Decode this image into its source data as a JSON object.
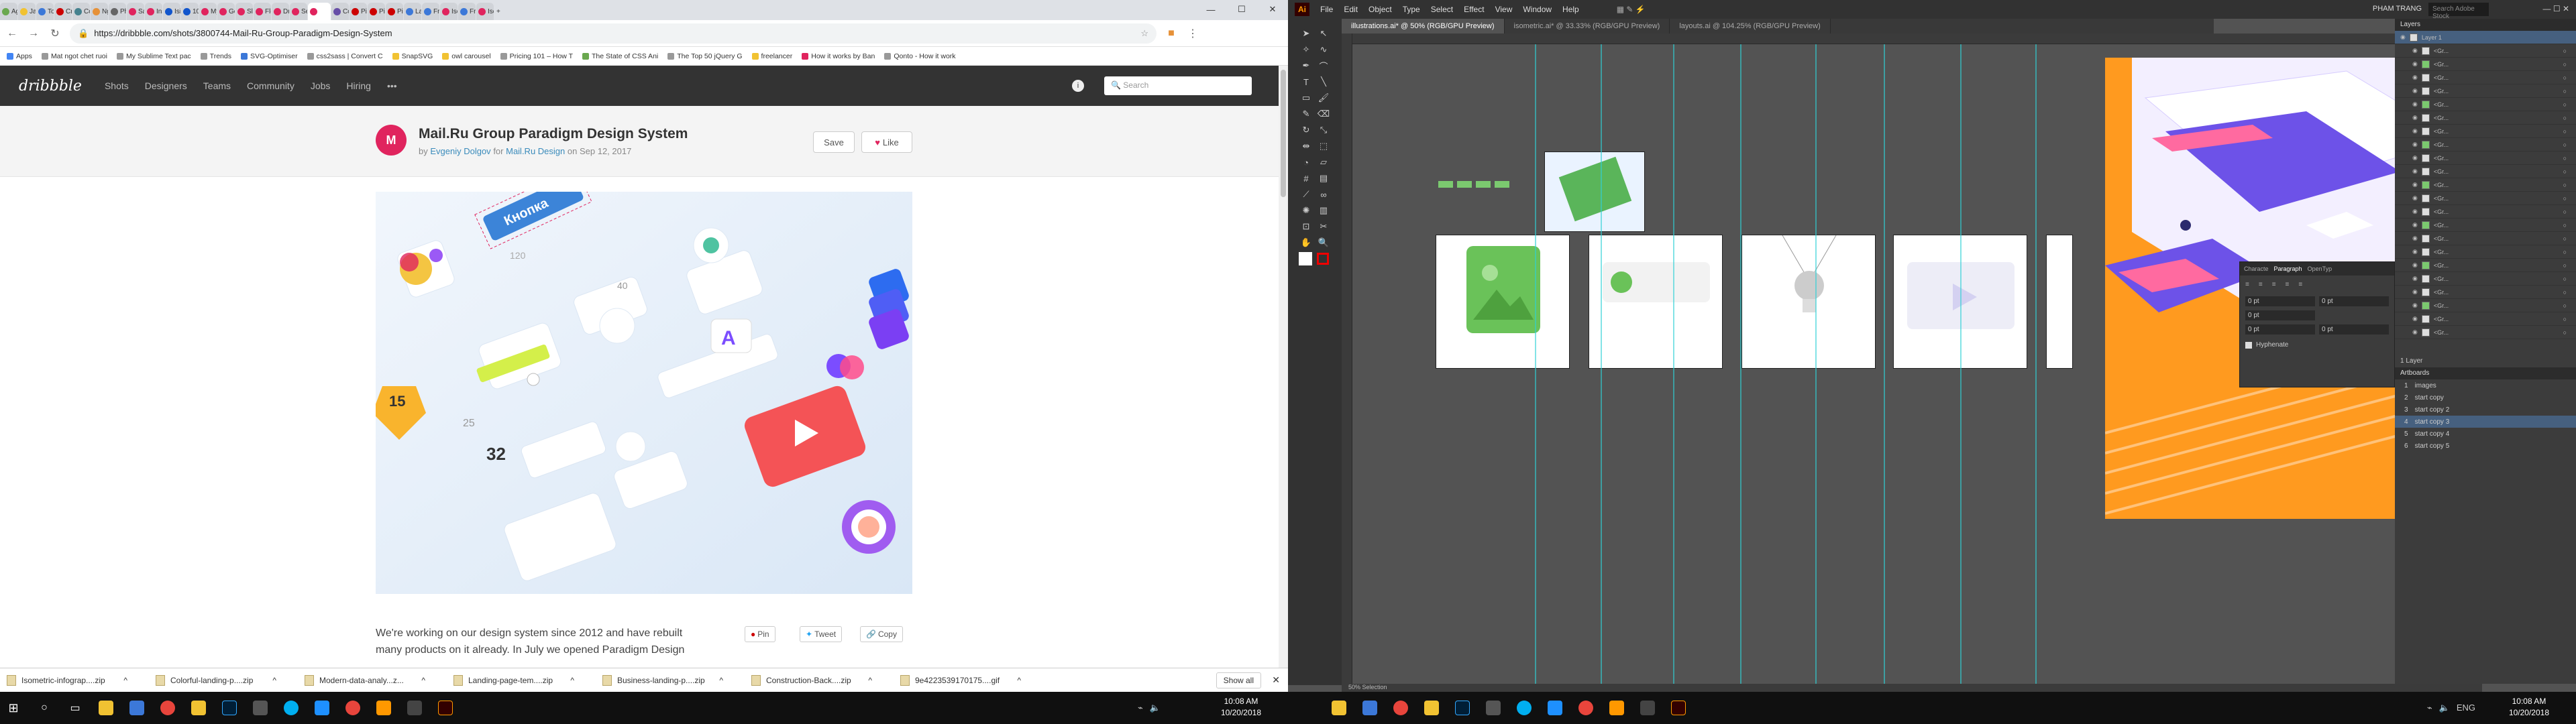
{
  "browser": {
    "tabs": [
      {
        "label": "Agi",
        "color": "#6aa84f"
      },
      {
        "label": "Jav",
        "color": "#f1c232"
      },
      {
        "label": "Toç",
        "color": "#3c78d8"
      },
      {
        "label": "Cre",
        "color": "#cc0000"
      },
      {
        "label": "Co",
        "color": "#45818e"
      },
      {
        "label": "Ng",
        "color": "#e69138"
      },
      {
        "label": "Phi",
        "color": "#666666"
      },
      {
        "label": "San",
        "color": "#e0245e"
      },
      {
        "label": "Ins",
        "color": "#e0245e"
      },
      {
        "label": "Isit",
        "color": "#1155cc"
      },
      {
        "label": "10(",
        "color": "#1155cc"
      },
      {
        "label": "My",
        "color": "#e0245e"
      },
      {
        "label": "Go",
        "color": "#e0245e"
      },
      {
        "label": "Sle",
        "color": "#e0245e"
      },
      {
        "label": "Flo",
        "color": "#e0245e"
      },
      {
        "label": "Dri",
        "color": "#e0245e"
      },
      {
        "label": "Ser",
        "color": "#e0245e"
      },
      {
        "label": "",
        "color": "#e0245e",
        "active": true
      },
      {
        "label": "Co",
        "color": "#674ea7"
      },
      {
        "label": "Pin",
        "color": "#cc0000"
      },
      {
        "label": "Pin",
        "color": "#cc0000"
      },
      {
        "label": "Pin",
        "color": "#cc0000"
      },
      {
        "label": "Lar",
        "color": "#3c78d8"
      },
      {
        "label": "Fre",
        "color": "#3c78d8"
      },
      {
        "label": "Iso",
        "color": "#e0245e"
      },
      {
        "label": "Fre",
        "color": "#3c78d8"
      },
      {
        "label": "Iso",
        "color": "#e0245e"
      }
    ],
    "url": "https://dribbble.com/shots/3800744-Mail-Ru-Group-Paradigm-Design-System",
    "bookmarks": [
      {
        "label": "Apps",
        "color": "#4285f4"
      },
      {
        "label": "Mat ngot chet ruoi",
        "color": "#999999"
      },
      {
        "label": "My Sublime Text pac",
        "color": "#999999"
      },
      {
        "label": "Trends",
        "color": "#999999"
      },
      {
        "label": "SVG-Optimiser",
        "color": "#3c78d8"
      },
      {
        "label": "css2sass | Convert C",
        "color": "#999999"
      },
      {
        "label": "SnapSVG",
        "color": "#f1c232"
      },
      {
        "label": "owl carousel",
        "color": "#f1c232"
      },
      {
        "label": "Pricing 101 – How T",
        "color": "#999999"
      },
      {
        "label": "The State of CSS Ani",
        "color": "#6aa84f"
      },
      {
        "label": "The Top 50 jQuery G",
        "color": "#999999"
      },
      {
        "label": "freelancer",
        "color": "#f1c232"
      },
      {
        "label": "How it works by Ban",
        "color": "#e0245e"
      },
      {
        "label": "Qonto - How it work",
        "color": "#999999"
      }
    ]
  },
  "dribbble": {
    "logo": "dribbble",
    "nav": [
      "Shots",
      "Designers",
      "Teams",
      "Community",
      "Jobs",
      "Hiring",
      "•••"
    ],
    "search_placeholder": "Search",
    "info": "i",
    "shot": {
      "title": "Mail.Ru Group Paradigm Design System",
      "by": "by",
      "author": "Evgeniy Dolgov",
      "for": "for",
      "team": "Mail.Ru Design",
      "on": "on",
      "date": "Sep 12, 2017",
      "avatar_letter": "M",
      "save_label": "Save",
      "like_label": "Like",
      "image_text": "Кнопка",
      "image_numbers": [
        "15",
        "25",
        "32",
        "40",
        "120"
      ],
      "description": "We're working on our design system since 2012 and have rebuilt many products on it already. In July we opened Paradigm Design",
      "share": [
        "Pin",
        "Tweet",
        "Copy"
      ]
    }
  },
  "downloads": {
    "items": [
      "Isometric-infograp....zip",
      "Colorful-landing-p....zip",
      "Modern-data-analy...z...",
      "Landing-page-tem....zip",
      "Business-landing-p....zip",
      "Construction-Back....zip",
      "9e4223539170175....gif"
    ],
    "show_all": "Show all"
  },
  "taskbar_left": {
    "time": "10:08 AM",
    "date": "10/20/2018"
  },
  "illustrator": {
    "menu": [
      "File",
      "Edit",
      "Object",
      "Type",
      "Select",
      "Effect",
      "View",
      "Window",
      "Help"
    ],
    "user": "PHAM TRANG",
    "search_placeholder": "Search Adobe Stock",
    "doc_tabs": [
      {
        "label": "illustrations.ai* @ 50% (RGB/GPU Preview)",
        "on": true
      },
      {
        "label": "isometric.ai* @ 33.33% (RGB/GPU Preview)",
        "on": false
      },
      {
        "label": "layouts.ai @ 104.25% (RGB/GPU Preview)",
        "on": false
      }
    ],
    "status": "50%   Selection",
    "layers_title": "Layers",
    "layer_main": "Layer 1",
    "layer_rows": [
      "<Gr...",
      "<Gr...",
      "<Gr...",
      "<Gr...",
      "<Gr...",
      "<Gr...",
      "<Gr...",
      "<Gr...",
      "<Gr...",
      "<Gr...",
      "<Gr...",
      "<Gr...",
      "<Gr...",
      "<Gr...",
      "<Gr...",
      "<Gr...",
      "<Gr...",
      "<Gr...",
      "<Gr...",
      "<Gr...",
      "<Gr...",
      "<Gr..."
    ],
    "layers_footer": "1 Layer",
    "artboards_title": "Artboards",
    "artboards": [
      {
        "num": "1",
        "name": "images"
      },
      {
        "num": "2",
        "name": "start copy"
      },
      {
        "num": "3",
        "name": "start copy 2"
      },
      {
        "num": "4",
        "name": "start copy 3",
        "on": true
      },
      {
        "num": "5",
        "name": "start copy 4"
      },
      {
        "num": "6",
        "name": "start copy 5"
      }
    ],
    "paragraph_tabs": [
      "Characte",
      "Paragraph",
      "OpenTyp"
    ],
    "paragraph_fields": [
      "0 pt",
      "0 pt",
      "0 pt",
      "0 pt",
      "0 pt"
    ],
    "hyphenate": "Hyphenate"
  },
  "taskbar_right": {
    "lang": "ENG",
    "time": "10:08 AM",
    "date": "10/20/2018"
  }
}
